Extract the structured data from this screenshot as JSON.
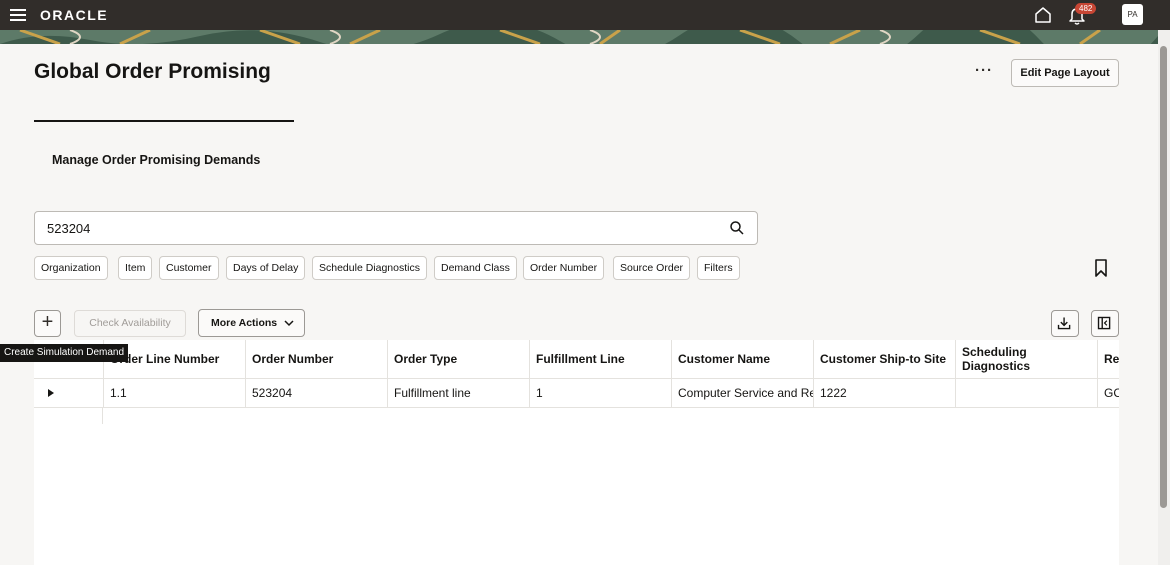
{
  "header": {
    "brand": "ORACLE",
    "notification_count": "482",
    "avatar_initials": "PA"
  },
  "page": {
    "title": "Global Order Promising",
    "edit_layout_label": "Edit Page Layout",
    "more_label": "···",
    "section_title": "Manage Order Promising Demands"
  },
  "search": {
    "value": "523204"
  },
  "filters": [
    "Organization",
    "Item",
    "Customer",
    "Days of Delay",
    "Schedule Diagnostics",
    "Demand Class",
    "Order Number",
    "Source Order",
    "Filters"
  ],
  "toolbar": {
    "add_label": "+",
    "check_availability_label": "Check Availability",
    "more_actions_label": "More Actions",
    "tooltip": "Create Simulation Demand"
  },
  "table": {
    "columns": [
      "Order Line Number",
      "Order Number",
      "Order Type",
      "Fulfillment Line",
      "Customer Name",
      "Customer Ship-to Site",
      "Scheduling Diagnostics",
      "Re"
    ],
    "rows": [
      [
        "1.1",
        "523204",
        "Fulfillment line",
        "1",
        "Computer Service and Re",
        "1222",
        "",
        "GC"
      ]
    ]
  },
  "colors": {
    "topbar": "#312d2a",
    "badge": "#c74634",
    "page_bg": "#f7f6f4"
  }
}
